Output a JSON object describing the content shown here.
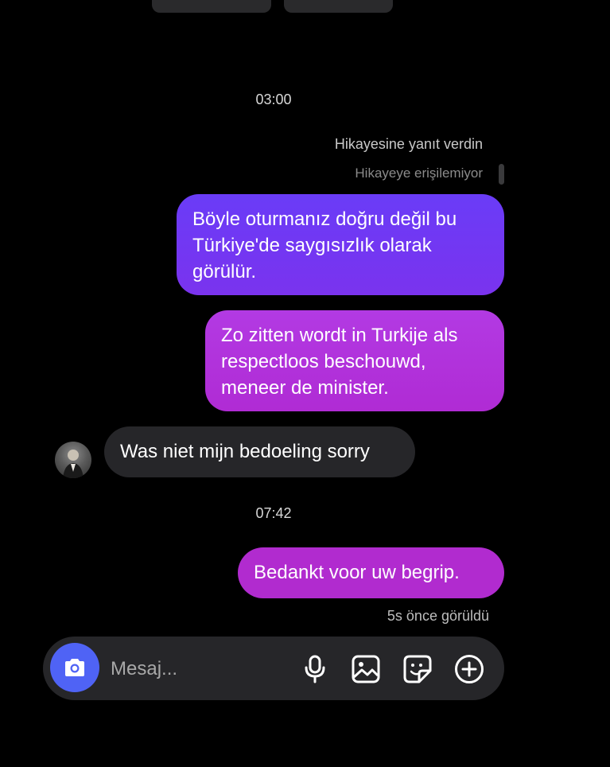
{
  "thread": {
    "time_1": "03:00",
    "story_reply_label": "Hikayesine yanıt verdin",
    "story_unavailable_label": "Hikayeye erişilemiyor",
    "time_2": "07:42",
    "seen_status": "5s önce görüldü"
  },
  "messages": [
    {
      "direction": "sent",
      "text": "Böyle oturmanız doğru değil bu Türkiye'de saygısızlık olarak görülür."
    },
    {
      "direction": "sent",
      "text": "Zo zitten wordt in Turkije als respectloos beschouwd, meneer de minister."
    },
    {
      "direction": "received",
      "text": "Was niet mijn bedoeling sorry"
    },
    {
      "direction": "sent",
      "text": "Bedankt voor uw begrip."
    }
  ],
  "composer": {
    "placeholder": "Mesaj...",
    "value": "",
    "icons": [
      "camera-icon",
      "microphone-icon",
      "gallery-icon",
      "sticker-icon",
      "add-icon"
    ]
  },
  "colors": {
    "background": "#000000",
    "sent_bubble_purple": "#6a3cf7",
    "sent_bubble_magenta": "#b12bcf",
    "received_bubble": "#262629",
    "camera_button": "#4f63f5"
  }
}
